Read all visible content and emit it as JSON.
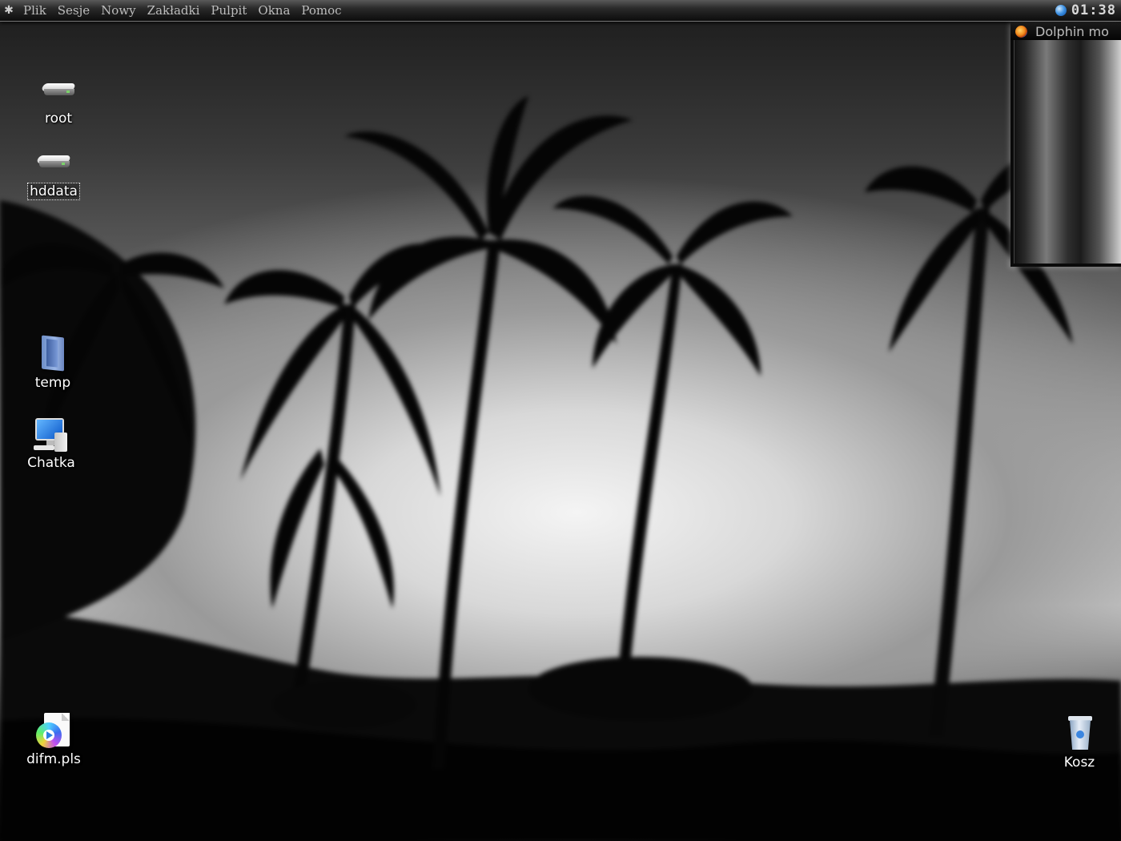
{
  "menubar": {
    "items": [
      "Plik",
      "Sesje",
      "Nowy",
      "Zakładki",
      "Pulpit",
      "Okna",
      "Pomoc"
    ],
    "clock": "01:38"
  },
  "dolphin_window": {
    "title": "Dolphin mo"
  },
  "desktop_icons": {
    "root": "root",
    "hddata": "hddata",
    "temp": "temp",
    "chatka": "Chatka",
    "difm": "difm.pls",
    "kosz": "Kosz"
  },
  "colors": {
    "menubar_text": "#bdbdbd",
    "icon_label": "#ffffff"
  }
}
